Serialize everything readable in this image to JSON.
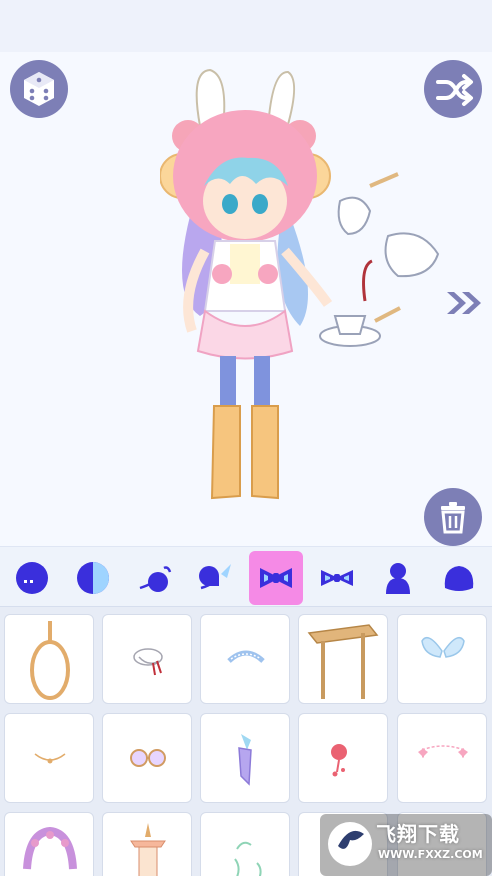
{
  "app": {
    "colors": {
      "accent": "#7d7fb6",
      "selected_tab": "#f58ae6",
      "icon_blue": "#3a2fdc",
      "stage_bg": "#f6f9ff"
    }
  },
  "stage": {
    "top_left_button": {
      "icon": "dice-icon"
    },
    "top_right_button": {
      "icon": "shuffle-icon"
    },
    "next_button": {
      "icon": "double-chevron-right-icon"
    },
    "delete_button": {
      "icon": "trash-icon"
    },
    "character": {
      "icon": "dressed-doll-character"
    }
  },
  "categories": {
    "selected_index": 4,
    "items": [
      {
        "icon": "face-icon"
      },
      {
        "icon": "face-half-icon"
      },
      {
        "icon": "ear-icon"
      },
      {
        "icon": "ear-accessory-icon"
      },
      {
        "icon": "bow-icon"
      },
      {
        "icon": "bow-outline-icon"
      },
      {
        "icon": "body-icon"
      },
      {
        "icon": "blob-icon"
      }
    ]
  },
  "items_grid": {
    "items": [
      {
        "icon": "rope-noose-icon"
      },
      {
        "icon": "hat-with-ribbons-icon"
      },
      {
        "icon": "headband-icon"
      },
      {
        "icon": "wooden-sign-icon"
      },
      {
        "icon": "wings-icon"
      },
      {
        "icon": "necklace-icon"
      },
      {
        "icon": "glasses-icon"
      },
      {
        "icon": "crystal-charm-icon"
      },
      {
        "icon": "rose-charm-icon"
      },
      {
        "icon": "pink-bow-chain-icon"
      },
      {
        "icon": "flower-arch-icon"
      },
      {
        "icon": "pagoda-lantern-icon"
      },
      {
        "icon": "green-ribbon-icon"
      },
      {
        "icon": "partial-item-icon"
      },
      {
        "icon": "partial-item-icon"
      }
    ]
  },
  "watermark": {
    "title": "飞翔下载",
    "url": "WWW.FXXZ.COM"
  }
}
